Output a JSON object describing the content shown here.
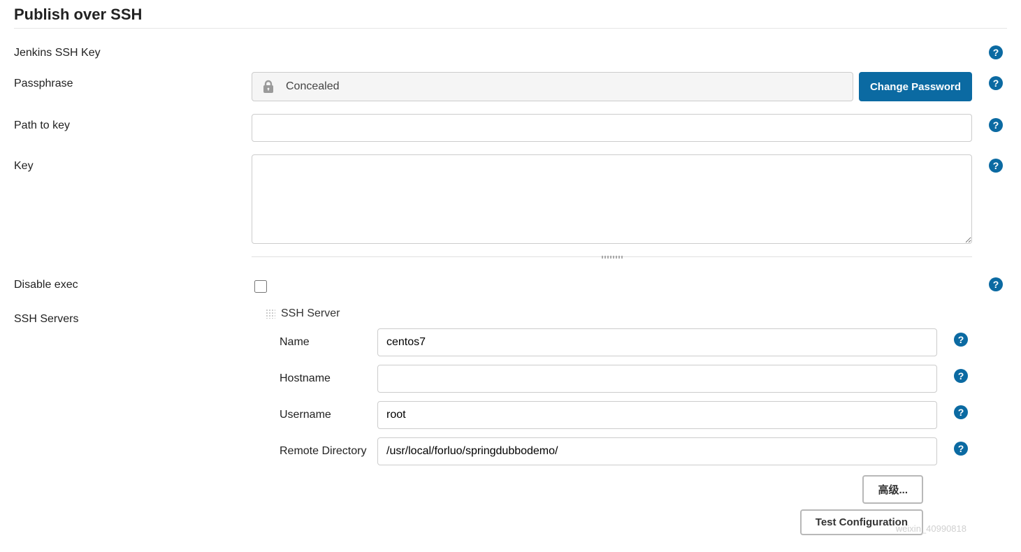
{
  "section": {
    "title": "Publish over SSH"
  },
  "labels": {
    "jenkins_key": "Jenkins SSH Key",
    "passphrase": "Passphrase",
    "path_to_key": "Path to key",
    "key": "Key",
    "disable_exec": "Disable exec",
    "ssh_servers": "SSH Servers"
  },
  "passphrase": {
    "concealed_text": "Concealed",
    "change_button": "Change Password"
  },
  "path_to_key": {
    "value": ""
  },
  "key": {
    "value": ""
  },
  "disable_exec": {
    "checked": false
  },
  "server": {
    "header": "SSH Server",
    "fields": {
      "name": {
        "label": "Name",
        "value": "centos7"
      },
      "hostname": {
        "label": "Hostname",
        "value": ""
      },
      "username": {
        "label": "Username",
        "value": "root"
      },
      "remote_dir": {
        "label": "Remote Directory",
        "value": "/usr/local/forluo/springdubbodemo/"
      }
    },
    "buttons": {
      "advanced": "高级...",
      "test": "Test Configuration"
    }
  },
  "help_glyph": "?",
  "watermark": "weixin_40990818"
}
